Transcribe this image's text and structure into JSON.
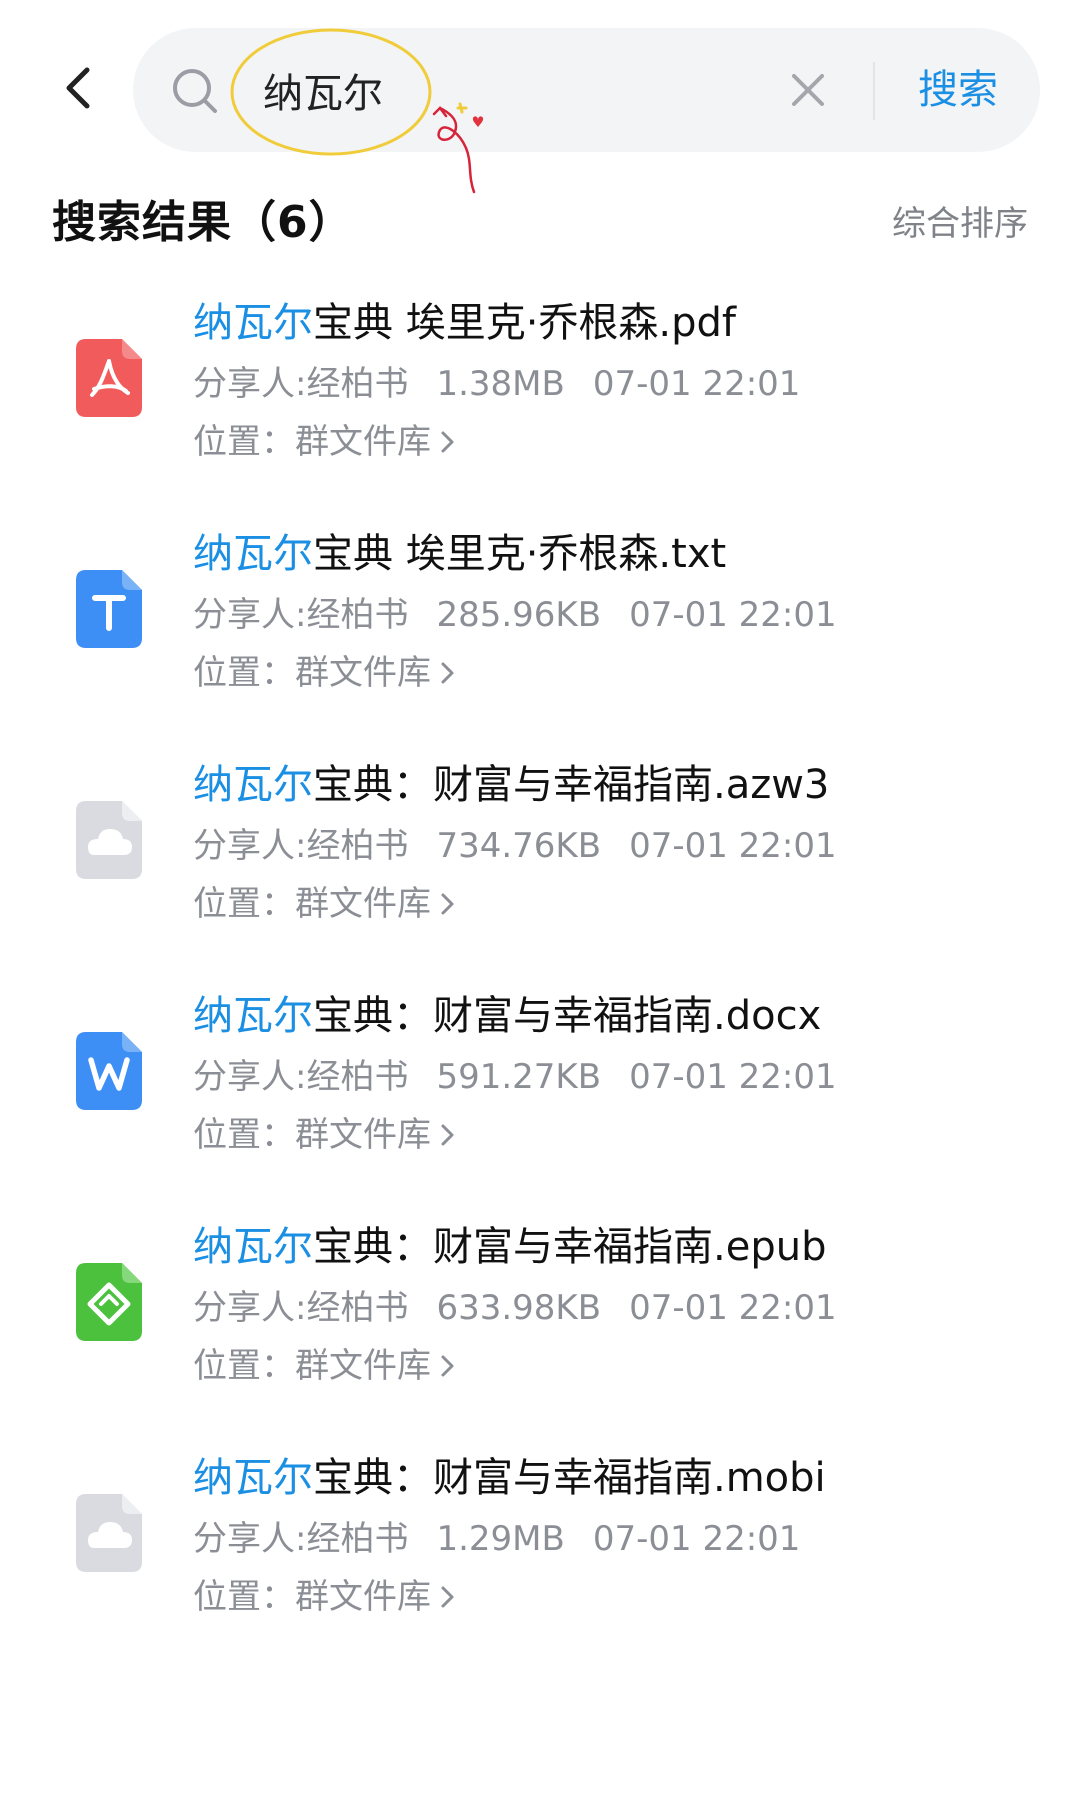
{
  "search": {
    "query": "纳瓦尔",
    "button_label": "搜索"
  },
  "results_header": {
    "title": "搜索结果（6）",
    "sort_label": "综合排序"
  },
  "accent_color": "#1a8fe3",
  "results": [
    {
      "name_highlight": "纳瓦尔",
      "name_rest": "宝典 埃里克·乔根森.pdf",
      "sharer": "分享人:经柏书",
      "size": "1.38MB",
      "time": "07-01 22:01",
      "location": "位置：群文件库",
      "icon": "pdf-icon",
      "icon_color": "#f25b5b"
    },
    {
      "name_highlight": "纳瓦尔",
      "name_rest": "宝典 埃里克·乔根森.txt",
      "sharer": "分享人:经柏书",
      "size": "285.96KB",
      "time": "07-01 22:01",
      "location": "位置：群文件库",
      "icon": "txt-icon",
      "icon_color": "#3d8ef5"
    },
    {
      "name_highlight": "纳瓦尔",
      "name_rest": "宝典：财富与幸福指南.azw3",
      "sharer": "分享人:经柏书",
      "size": "734.76KB",
      "time": "07-01 22:01",
      "location": "位置：群文件库",
      "icon": "cloud-file-icon",
      "icon_color": "#d9dbe0"
    },
    {
      "name_highlight": "纳瓦尔",
      "name_rest": "宝典：财富与幸福指南.docx",
      "sharer": "分享人:经柏书",
      "size": "591.27KB",
      "time": "07-01 22:01",
      "location": "位置：群文件库",
      "icon": "word-icon",
      "icon_color": "#3d8ef5"
    },
    {
      "name_highlight": "纳瓦尔",
      "name_rest": "宝典：财富与幸福指南.epub",
      "sharer": "分享人:经柏书",
      "size": "633.98KB",
      "time": "07-01 22:01",
      "location": "位置：群文件库",
      "icon": "epub-icon",
      "icon_color": "#4cc13e"
    },
    {
      "name_highlight": "纳瓦尔",
      "name_rest": "宝典：财富与幸福指南.mobi",
      "sharer": "分享人:经柏书",
      "size": "1.29MB",
      "time": "07-01 22:01",
      "location": "位置：群文件库",
      "icon": "cloud-file-icon",
      "icon_color": "#d9dbe0"
    }
  ]
}
